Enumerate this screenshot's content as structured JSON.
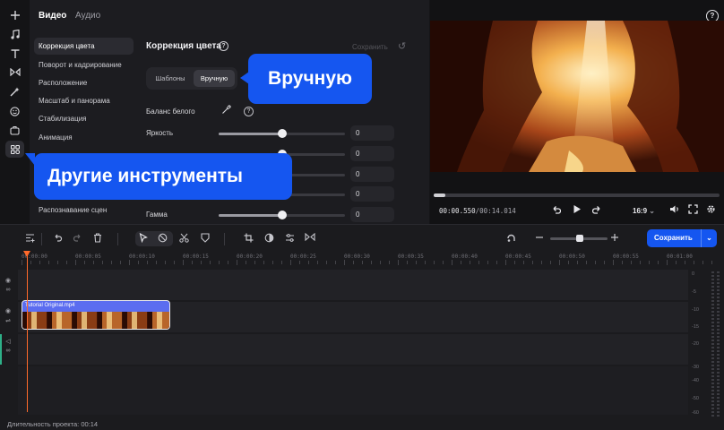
{
  "rail": {
    "icons": [
      "plus-icon",
      "music-icon",
      "text-icon",
      "transitions-icon",
      "effects-icon",
      "stickers-icon",
      "overlay-icon",
      "more-tools-icon"
    ]
  },
  "panel": {
    "tabs": [
      {
        "label": "Видео",
        "active": true
      },
      {
        "label": "Аудио",
        "active": false
      }
    ],
    "nav": [
      {
        "label": "Коррекция цвета",
        "active": true
      },
      {
        "label": "Поворот и кадрирование"
      },
      {
        "label": "Расположение"
      },
      {
        "label": "Масштаб и панорама"
      },
      {
        "label": "Стабилизация"
      },
      {
        "label": "Анимация"
      },
      {
        "label": "Распознавание сцен"
      }
    ],
    "section_title": "Коррекция цвета",
    "save_preset": "Сохранить",
    "mode_tabs": [
      {
        "label": "Шаблоны"
      },
      {
        "label": "Вручную",
        "active": true
      }
    ],
    "white_balance_label": "Баланс белого",
    "sliders": [
      {
        "label": "Яркость",
        "value": "0",
        "level": 0.5
      },
      {
        "label": "",
        "value": "0",
        "level": 0.5
      },
      {
        "label": "",
        "value": "0",
        "level": 0.5
      },
      {
        "label": "",
        "value": "0",
        "level": 0.5
      },
      {
        "label": "Гамма",
        "value": "0",
        "level": 0.5
      }
    ]
  },
  "callouts": {
    "manual": "Вручную",
    "tools": "Другие инструменты"
  },
  "preview": {
    "time_current": "00:00.550",
    "time_total": "/00:14.014",
    "progress": 0.04,
    "aspect": "16:9",
    "aspect_caret": "⌄"
  },
  "timeline": {
    "save_label": "Сохранить",
    "ruler": [
      "00:00:00",
      "00:00:05",
      "00:00:10",
      "00:00:15",
      "00:00:20",
      "00:00:25",
      "00:00:30",
      "00:00:35",
      "00:00:40",
      "00:00:45",
      "00:00:50",
      "00:00:55",
      "00:01:00"
    ],
    "clip_name": "Tutorial Original.mp4",
    "duration": "Длительность проекта: 00:14",
    "db_scale": [
      "0",
      "-5",
      "-10",
      "-15",
      "-20",
      "-30",
      "-40",
      "-50",
      "-60"
    ],
    "zoom_level": 0.52
  },
  "colors": {
    "accent": "#1556f0",
    "playhead": "#ff6a2b",
    "clip": "#5b6df0"
  }
}
